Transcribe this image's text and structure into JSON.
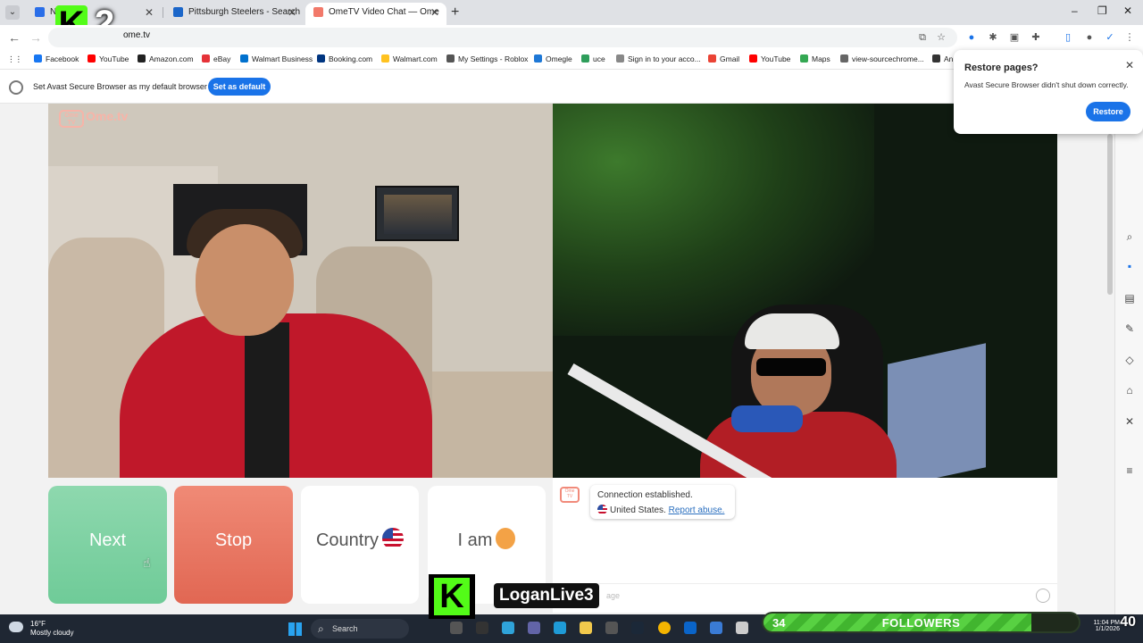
{
  "tabs": [
    {
      "label": "NF",
      "active": false
    },
    {
      "label": "Pittsburgh Steelers - Search",
      "active": false
    },
    {
      "label": "OmeTV Video Chat — Ome",
      "active": true
    }
  ],
  "address": {
    "url": "ome.tv"
  },
  "bookmarks": [
    "Facebook",
    "YouTube",
    "Amazon.com",
    "eBay",
    "Walmart Business",
    "Booking.com",
    "Walmart.com",
    "My Settings - Roblox",
    "Omegle",
    "uce",
    "Sign in to your acco...",
    "Gmail",
    "YouTube",
    "Maps",
    "view-sourcechrome...",
    "An"
  ],
  "infobar": {
    "text": "Set Avast Secure Browser as my default browser",
    "button": "Set as default"
  },
  "restore_popup": {
    "title": "Restore pages?",
    "desc": "Avast Secure Browser didn't shut down correctly.",
    "button": "Restore"
  },
  "site": {
    "logo": "Ome.tv",
    "badge": "Ome TV"
  },
  "controls": {
    "next": "Next",
    "stop": "Stop",
    "country": "Country",
    "iam": "I am"
  },
  "chat": {
    "line1": "Connection established.",
    "country": "United States.",
    "report": "Report abuse.",
    "placeholder": "age"
  },
  "overlay": {
    "k2_letter": "K",
    "k2_number": "2",
    "kick_letter": "K",
    "username": "LoganLive3",
    "followers_count": "34",
    "followers_label": "FOLLOWERS",
    "followers_goal": "40",
    "followers_progress": 0.85
  },
  "taskbar": {
    "temp": "16°F",
    "condition": "Mostly cloudy",
    "search": "Search",
    "time": "11:04 PM",
    "date": "1/1/2026"
  },
  "colors": {
    "kick_green": "#53fc18",
    "next": "#7fd3a4",
    "stop": "#e8725e",
    "accent_blue": "#1a73e8"
  }
}
